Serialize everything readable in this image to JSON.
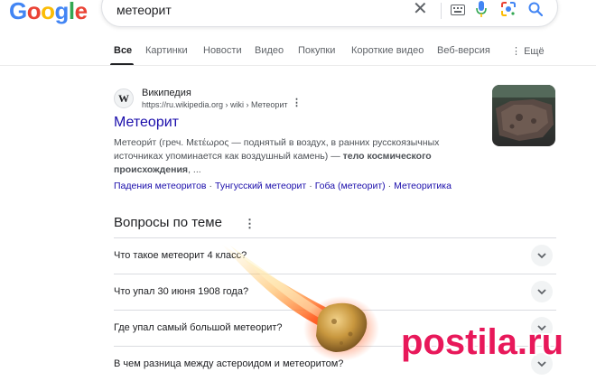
{
  "header": {
    "logo_letters": [
      {
        "char": "G",
        "color": "#4285F4"
      },
      {
        "char": "o",
        "color": "#EA4335"
      },
      {
        "char": "o",
        "color": "#FBBC05"
      },
      {
        "char": "g",
        "color": "#4285F4"
      },
      {
        "char": "l",
        "color": "#34A853"
      },
      {
        "char": "e",
        "color": "#EA4335"
      }
    ],
    "search_query": "метеорит",
    "icons": [
      "clear-icon",
      "keyboard-icon",
      "mic-icon",
      "lens-icon",
      "search-icon"
    ]
  },
  "tabs": [
    {
      "label": "Все",
      "active": true
    },
    {
      "label": "Картинки"
    },
    {
      "label": "Новости"
    },
    {
      "label": "Видео"
    },
    {
      "label": "Покупки"
    },
    {
      "label": "Короткие видео"
    },
    {
      "label": "Веб-версия"
    },
    {
      "label": "Ещё"
    }
  ],
  "result": {
    "favicon_letter": "W",
    "site_name": "Википедия",
    "url": "https://ru.wikipedia.org › wiki › Метеорит",
    "title": "Метеорит",
    "snippet_1": "Метеори́т (греч. Μετέωρος — поднятый в воздух, в ранних русскоязычных источниках упоминается как воздушный камень) —",
    "snippet_bold": "тело космического происхождения",
    "snippet_2": ", ...",
    "sitelinks": [
      "Падения метеоритов",
      "Тунгусский метеорит",
      "Гоба (метеорит)",
      "Метеоритика"
    ]
  },
  "paa": {
    "title": "Вопросы по теме",
    "questions": [
      "Что такое метеорит 4 класс?",
      "Что упал 30 июня 1908 года?",
      "Где упал самый большой метеорит?",
      "В чем разница между астероидом и метеоритом?"
    ]
  },
  "watermark": {
    "text": "postila.ru",
    "color": "#e8185a"
  },
  "colors": {
    "link": "#1a0dab",
    "text": "#202124",
    "muted": "#4d5156"
  }
}
